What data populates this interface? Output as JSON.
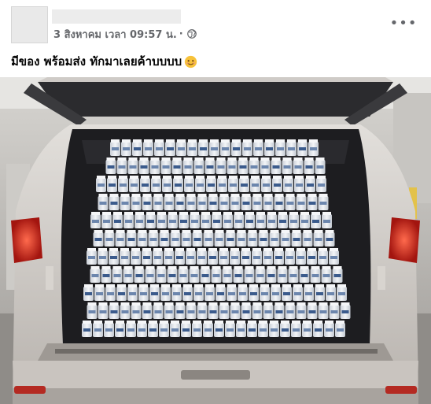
{
  "post": {
    "timestamp": "3 สิงหาคม เวลา 09:57 น.",
    "separator": "·",
    "caption": "มีของ พร้อมส่ง ทักมาเลยค้าบบบบ",
    "caption_emoji": "smiling-face-icon",
    "privacy_icon": "globe-icon",
    "more_icon": "more-options-icon",
    "more_label": "•••"
  },
  "photo": {
    "subject": "car-trunk-full-of-bottles",
    "colors": {
      "car_body": "#cfcac6",
      "interior": "#1d1d20",
      "bottles": "#e8ecf1",
      "tail_light": "#d9302a",
      "garage": "#b8b6b3"
    }
  }
}
